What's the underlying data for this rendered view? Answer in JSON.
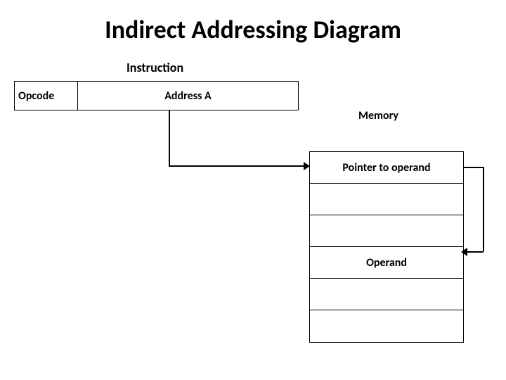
{
  "title": "Indirect Addressing Diagram",
  "instruction_label": "Instruction",
  "instruction": {
    "opcode": "Opcode",
    "address": "Address A"
  },
  "memory_label": "Memory",
  "memory_cells": {
    "pointer": "Pointer to operand",
    "blank1": "",
    "blank2": "",
    "operand": "Operand",
    "blank3": "",
    "blank4": ""
  }
}
